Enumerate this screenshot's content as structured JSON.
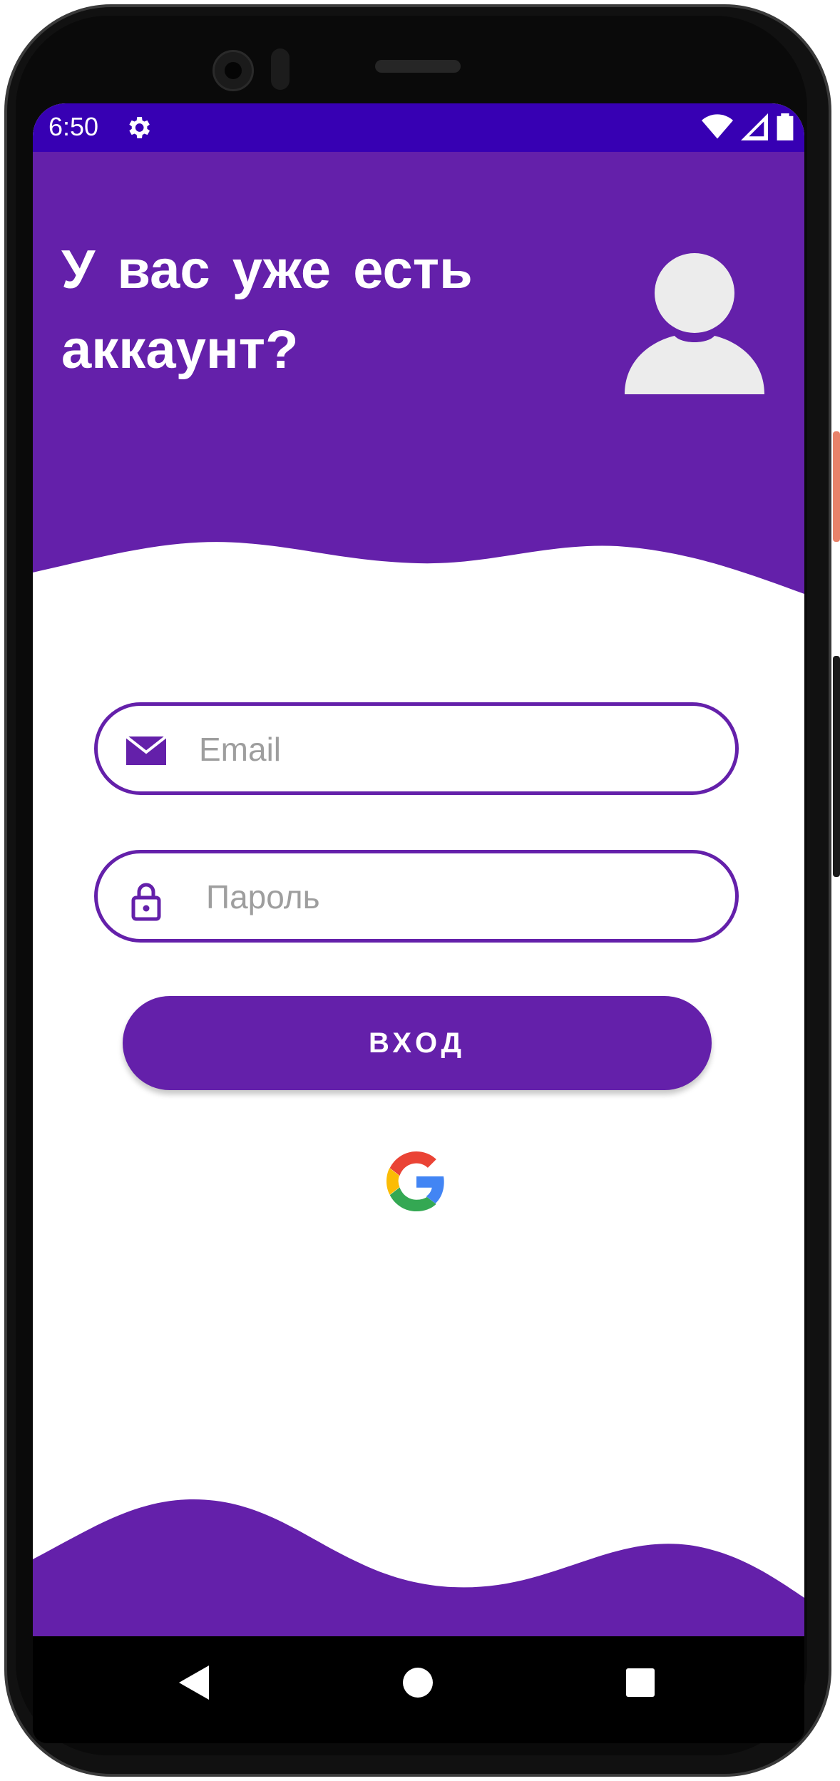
{
  "status_bar": {
    "time": "6:50",
    "settings_icon": "gear-icon",
    "wifi_icon": "wifi-icon",
    "signal_icon": "signal-icon",
    "battery_icon": "battery-icon"
  },
  "header": {
    "title": "У вас уже есть аккаунт?",
    "avatar_icon": "user-avatar-icon"
  },
  "form": {
    "email": {
      "icon": "envelope-icon",
      "placeholder": "Email",
      "value": ""
    },
    "password": {
      "icon": "lock-icon",
      "placeholder": "Пароль",
      "value": ""
    },
    "login_label": "ВХОД",
    "google_icon": "google-logo-icon"
  },
  "nav": {
    "back_icon": "back-triangle-icon",
    "home_icon": "home-circle-icon",
    "recents_icon": "recents-square-icon"
  },
  "colors": {
    "primary": "#6420aa",
    "status_bar": "#3700b3",
    "placeholder": "#9e9e9e",
    "background": "#ffffff"
  }
}
